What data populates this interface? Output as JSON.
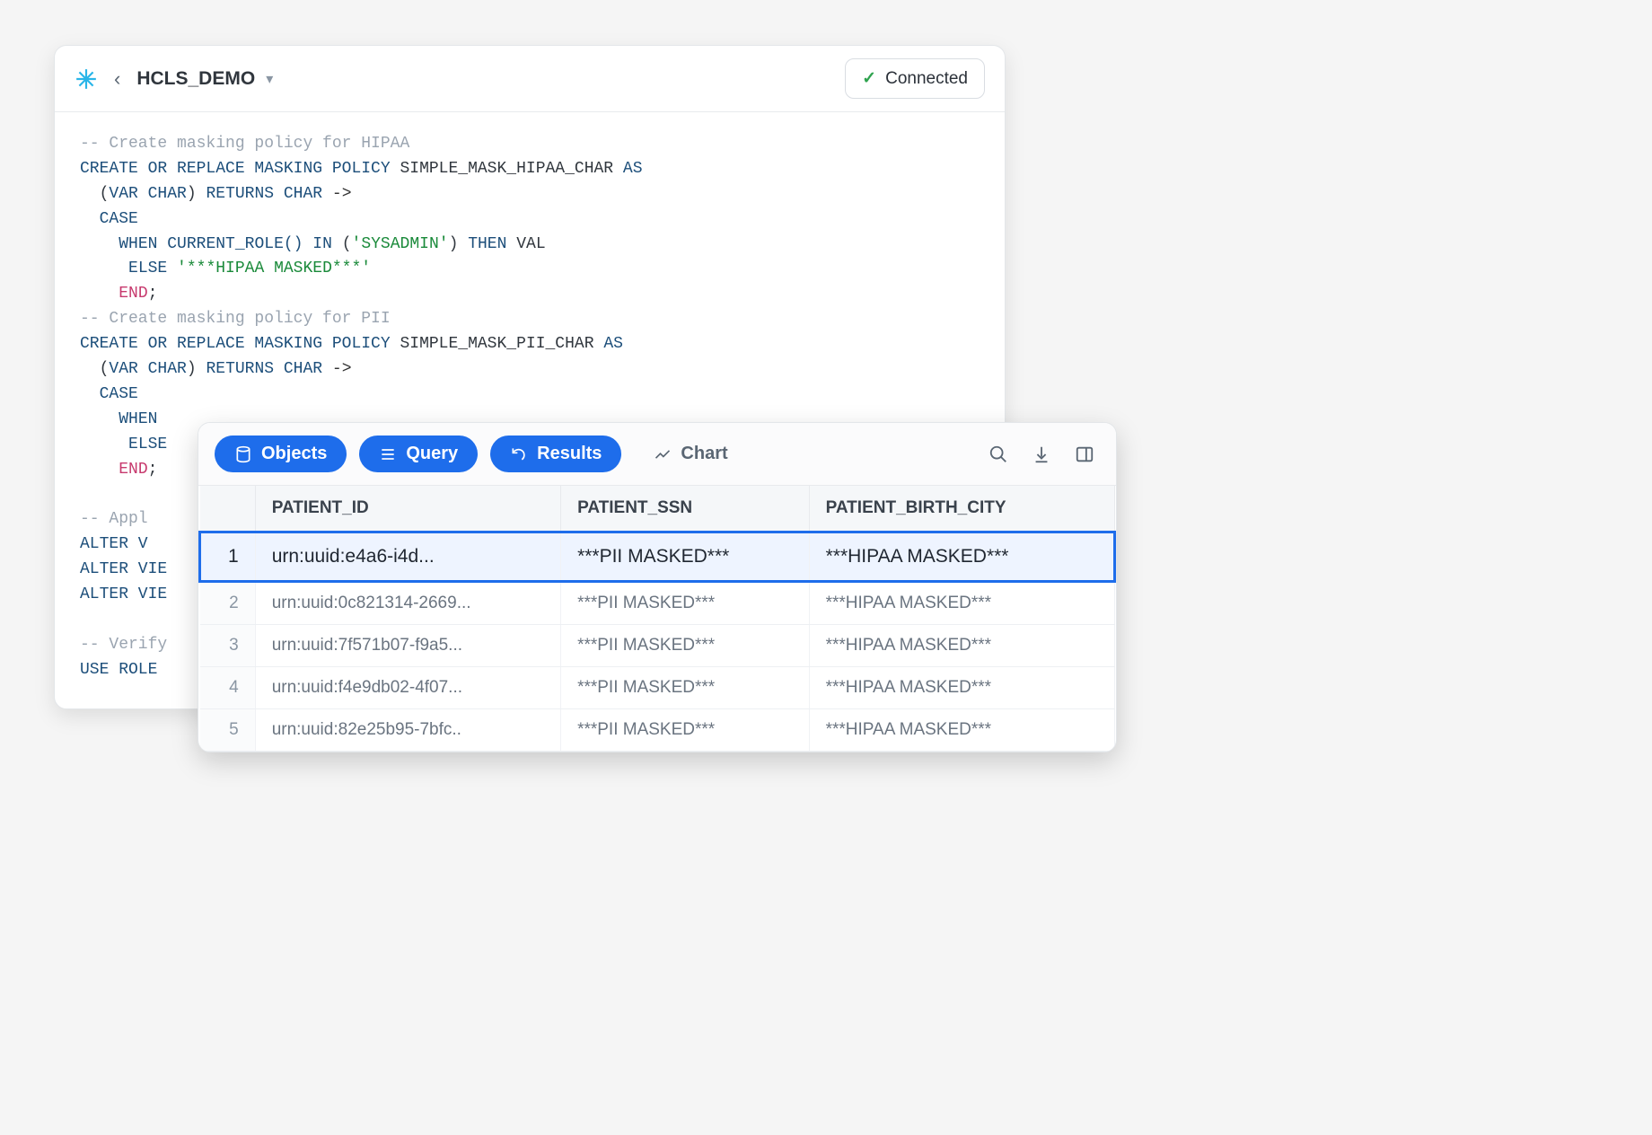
{
  "header": {
    "worksheet_name": "HCLS_DEMO",
    "connection_status": "Connected"
  },
  "code_lines": [
    {
      "segments": [
        {
          "cls": "c-comment",
          "t": "-- Create masking policy for HIPAA"
        }
      ]
    },
    {
      "segments": [
        {
          "cls": "c-key",
          "t": "CREATE OR REPLACE MASKING POLICY"
        },
        {
          "cls": "",
          "t": " "
        },
        {
          "cls": "c-ident",
          "t": "SIMPLE_MASK_HIPAA_CHAR"
        },
        {
          "cls": "",
          "t": " "
        },
        {
          "cls": "c-key",
          "t": "AS"
        }
      ]
    },
    {
      "segments": [
        {
          "cls": "",
          "t": "  "
        },
        {
          "cls": "c-paren",
          "t": "("
        },
        {
          "cls": "c-key",
          "t": "VAR CHAR"
        },
        {
          "cls": "c-paren",
          "t": ")"
        },
        {
          "cls": "",
          "t": " "
        },
        {
          "cls": "c-key",
          "t": "RETURNS CHAR"
        },
        {
          "cls": "",
          "t": " ->"
        }
      ]
    },
    {
      "segments": [
        {
          "cls": "",
          "t": "  "
        },
        {
          "cls": "c-key",
          "t": "CASE"
        }
      ]
    },
    {
      "segments": [
        {
          "cls": "",
          "t": "    "
        },
        {
          "cls": "c-key",
          "t": "WHEN"
        },
        {
          "cls": "",
          "t": " "
        },
        {
          "cls": "c-func",
          "t": "CURRENT_ROLE()"
        },
        {
          "cls": "",
          "t": " "
        },
        {
          "cls": "c-key",
          "t": "IN"
        },
        {
          "cls": "",
          "t": " "
        },
        {
          "cls": "c-paren",
          "t": "("
        },
        {
          "cls": "c-str",
          "t": "'SYSADMIN'"
        },
        {
          "cls": "c-paren",
          "t": ")"
        },
        {
          "cls": "",
          "t": " "
        },
        {
          "cls": "c-key",
          "t": "THEN"
        },
        {
          "cls": "",
          "t": " "
        },
        {
          "cls": "c-ident",
          "t": "VAL"
        }
      ]
    },
    {
      "segments": [
        {
          "cls": "",
          "t": "     "
        },
        {
          "cls": "c-key",
          "t": "ELSE"
        },
        {
          "cls": "",
          "t": " "
        },
        {
          "cls": "c-str",
          "t": "'***HIPAA MASKED***'"
        }
      ]
    },
    {
      "segments": [
        {
          "cls": "",
          "t": "    "
        },
        {
          "cls": "c-end",
          "t": "END"
        },
        {
          "cls": "c-ident",
          "t": ";"
        }
      ]
    },
    {
      "segments": [
        {
          "cls": "c-comment",
          "t": "-- Create masking policy for PII"
        }
      ]
    },
    {
      "segments": [
        {
          "cls": "c-key",
          "t": "CREATE OR REPLACE MASKING POLICY"
        },
        {
          "cls": "",
          "t": " "
        },
        {
          "cls": "c-ident",
          "t": "SIMPLE_MASK_PII_CHAR"
        },
        {
          "cls": "",
          "t": " "
        },
        {
          "cls": "c-key",
          "t": "AS"
        }
      ]
    },
    {
      "segments": [
        {
          "cls": "",
          "t": "  "
        },
        {
          "cls": "c-paren",
          "t": "("
        },
        {
          "cls": "c-key",
          "t": "VAR CHAR"
        },
        {
          "cls": "c-paren",
          "t": ")"
        },
        {
          "cls": "",
          "t": " "
        },
        {
          "cls": "c-key",
          "t": "RETURNS CHAR"
        },
        {
          "cls": "",
          "t": " ->"
        }
      ]
    },
    {
      "segments": [
        {
          "cls": "",
          "t": "  "
        },
        {
          "cls": "c-key",
          "t": "CASE"
        }
      ]
    },
    {
      "segments": [
        {
          "cls": "",
          "t": "    "
        },
        {
          "cls": "c-key",
          "t": "WHEN"
        }
      ]
    },
    {
      "segments": [
        {
          "cls": "",
          "t": "     "
        },
        {
          "cls": "c-key",
          "t": "ELSE"
        }
      ]
    },
    {
      "segments": [
        {
          "cls": "",
          "t": "    "
        },
        {
          "cls": "c-end",
          "t": "END"
        },
        {
          "cls": "c-ident",
          "t": ";"
        }
      ]
    },
    {
      "segments": [
        {
          "cls": "",
          "t": ""
        }
      ]
    },
    {
      "segments": [
        {
          "cls": "c-comment",
          "t": "-- Appl"
        }
      ]
    },
    {
      "segments": [
        {
          "cls": "c-key",
          "t": "ALTER V"
        }
      ]
    },
    {
      "segments": [
        {
          "cls": "c-key",
          "t": "ALTER VIE"
        }
      ]
    },
    {
      "segments": [
        {
          "cls": "c-key",
          "t": "ALTER VIE"
        }
      ]
    },
    {
      "segments": [
        {
          "cls": "",
          "t": ""
        }
      ]
    },
    {
      "segments": [
        {
          "cls": "c-comment",
          "t": "-- Verify"
        }
      ]
    },
    {
      "segments": [
        {
          "cls": "c-key",
          "t": "USE ROLE"
        }
      ]
    }
  ],
  "tabs": {
    "objects": "Objects",
    "query": "Query",
    "results": "Results",
    "chart": "Chart"
  },
  "columns": [
    "PATIENT_ID",
    "PATIENT_SSN",
    "PATIENT_BIRTH_CITY"
  ],
  "rows": [
    {
      "n": "1",
      "id": "urn:uuid:e4a6-i4d...",
      "ssn": "***PII MASKED***",
      "city": "***HIPAA MASKED***"
    },
    {
      "n": "2",
      "id": "urn:uuid:0c821314-2669...",
      "ssn": "***PII MASKED***",
      "city": "***HIPAA MASKED***"
    },
    {
      "n": "3",
      "id": "urn:uuid:7f571b07-f9a5...",
      "ssn": "***PII MASKED***",
      "city": "***HIPAA MASKED***"
    },
    {
      "n": "4",
      "id": "urn:uuid:f4e9db02-4f07...",
      "ssn": "***PII MASKED***",
      "city": "***HIPAA MASKED***"
    },
    {
      "n": "5",
      "id": "urn:uuid:82e25b95-7bfc..",
      "ssn": "***PII MASKED***",
      "city": "***HIPAA MASKED***"
    }
  ]
}
